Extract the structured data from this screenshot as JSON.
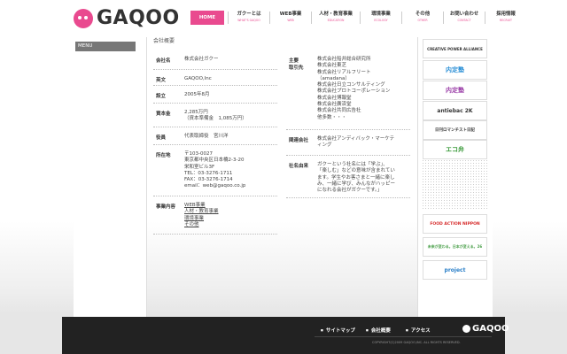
{
  "header": {
    "logo_text": "GAQOO",
    "nav": [
      {
        "jp": "HOME",
        "en": ""
      },
      {
        "jp": "ガクーとは",
        "en": "WHAT'S GAQOO"
      },
      {
        "jp": "WEB事業",
        "en": "WEB"
      },
      {
        "jp": "人材・教育事業",
        "en": "EDUCATION"
      },
      {
        "jp": "環境事業",
        "en": "ECOLOGY"
      },
      {
        "jp": "その他",
        "en": "OTHER"
      },
      {
        "jp": "お問い合わせ",
        "en": "CONTACT"
      },
      {
        "jp": "採用情報",
        "en": "RECRUIT"
      }
    ]
  },
  "sidebar": {
    "menu_label": "MENU"
  },
  "main": {
    "title": "会社概要",
    "company": {
      "label": "会社名",
      "value": "株式会社ガクー"
    },
    "english": {
      "label": "英文",
      "value": "GAQOO,Inc"
    },
    "founded": {
      "label": "設立",
      "value": "2005年8月"
    },
    "capital": {
      "label": "資本金",
      "lines": [
        "2,285万円",
        "（資本準備金　1,085万円）"
      ]
    },
    "officer": {
      "label": "役員",
      "value": "代表取締役　宮川洋"
    },
    "address": {
      "label": "所在地",
      "lines": [
        "〒103-0027",
        "東京都中央区日本橋2-3-20",
        "栄和室ビル3F",
        "TEL：03-3276-1711",
        "FAX：03-3276-1714",
        "email：web@gaqoo.co.jp"
      ]
    },
    "business": {
      "label": "事業内容",
      "links": [
        "WEB事業",
        "人材・教育事業",
        "環境事業",
        "その他"
      ]
    },
    "clients": {
      "label_line1": "主要",
      "label_line2": "取引先",
      "lines": [
        "株式会社船井総合研究所",
        "株式会社東芝",
        "株式会社リアルフリート",
        "（amadana）",
        "株式会社日立コンサルティング",
        "株式会社プロトコーポレーション",
        "株式会社博報堂",
        "株式会社廣済堂",
        "株式会社共同広告社",
        "他多数・・・"
      ]
    },
    "affiliate": {
      "label": "関連会社",
      "lines": [
        "株式会社アンディバック・マーケテ",
        "ィング"
      ]
    },
    "origin": {
      "label": "社名由来",
      "lines": [
        "ガクーという社名には「学ぶ」、",
        "「楽しむ」などの意味が含まれてい",
        "ます。学生やお客さまと一緒に楽し",
        "み、一緒に学び、みんながハッピー",
        "になれる会社がガクーです。」"
      ]
    }
  },
  "banners": [
    {
      "label": "CREATIVE POWER ALLIANCE",
      "color": "#333333"
    },
    {
      "label": "内定塾",
      "color": "#2a8fd6"
    },
    {
      "label": "内定塾",
      "color": "#9b3fa8"
    },
    {
      "label": "antiebac 2K",
      "color": "#333333"
    },
    {
      "label": "日刊ロマンチスト日記",
      "color": "#333333"
    },
    {
      "label": "エコ弁",
      "color": "#3a9a3a"
    },
    {
      "label": "FOOD ACTION NIPPON",
      "color": "#d62b2b"
    },
    {
      "label": "未来が変わる。日本が変える。26",
      "color": "#4aa04a"
    },
    {
      "label": "project",
      "color": "#2a7fc8"
    }
  ],
  "footer": {
    "links": [
      "サイトマップ",
      "会社概要",
      "アクセス"
    ],
    "logo_text": "GAQOO",
    "copyright": "COPYRIGHT(C)2009 GAQOO,INC. ALL RIGHTS RESERVED."
  },
  "colors": {
    "accent": "#e94a8f",
    "footer_bg": "#222222"
  }
}
